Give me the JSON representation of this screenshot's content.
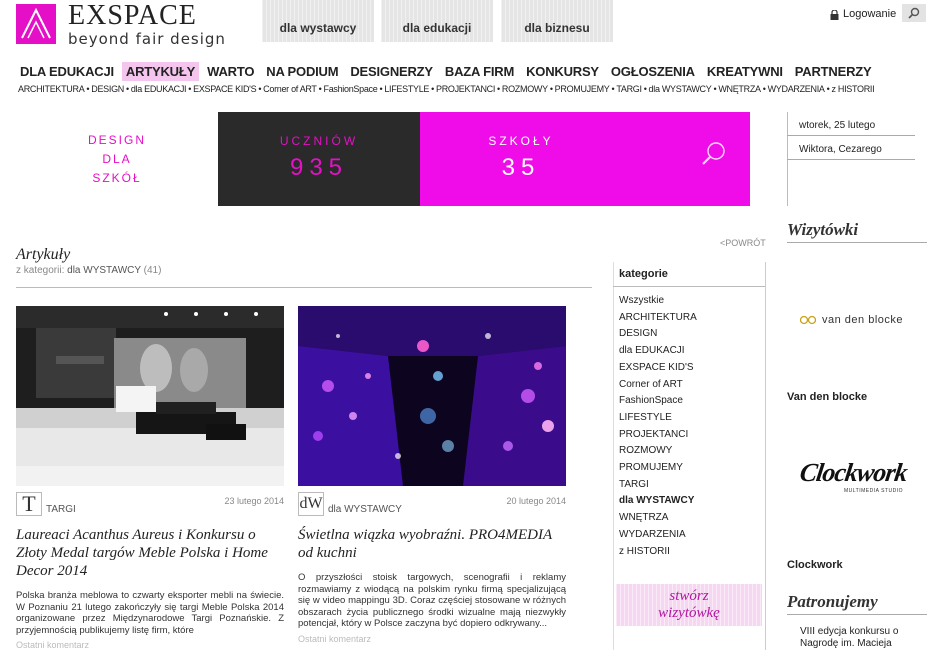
{
  "header": {
    "brand": "EXSPACE",
    "tagline": "beyond fair design",
    "top_tabs": [
      "dla wystawcy",
      "dla edukacji",
      "dla biznesu"
    ],
    "login_label": "Logowanie"
  },
  "main_nav": [
    "DLA EDUKACJI",
    "ARTYKUŁY",
    "WARTO",
    "NA PODIUM",
    "DESIGNERZY",
    "BAZA FIRM",
    "KONKURSY",
    "OGŁOSZENIA",
    "KREATYWNI",
    "PARTNERZY"
  ],
  "sub_nav": [
    "ARCHITEKTURA",
    "DESIGN",
    "dla EDUKACJI",
    "EXSPACE KID'S",
    "Corner of ART",
    "FashionSpace",
    "LIFESTYLE",
    "PROJEKTANCI",
    "ROZMOWY",
    "PROMUJEMY",
    "TARGI",
    "dla WYSTAWCY",
    "WNĘTRZA",
    "WYDARZENIA",
    "z HISTORII"
  ],
  "banner": {
    "left_lines": [
      "DESIGN",
      "DLA",
      "SZKÓŁ"
    ],
    "students_label": "UCZNIÓW",
    "students_value": "935",
    "schools_label": "SZKOŁY",
    "schools_value": "35"
  },
  "date_box": {
    "date": "wtorek, 25 lutego",
    "names": "Wiktora, Cezarego"
  },
  "articles": {
    "title": "Artykuły",
    "from_category_prefix": "z kategorii:",
    "category": "dla WYSTAWCY",
    "count": "(41)",
    "back_label": "<POWRÓT",
    "items": [
      {
        "category_letter": "T",
        "category": "TARGI",
        "date": "23 lutego 2014",
        "title": "Laureaci Acanthus Aureus i Konkursu o Złoty Medal targów Meble Polska i Home Decor 2014",
        "text": "Polska branża meblowa to czwarty eksporter mebli na świecie. W Poznaniu 21 lutego zakończyły się targi Meble Polska 2014 organizowane przez Międzynarodowe Targi Poznańskie. Z przyjemnością publikujemy listę firm, które",
        "comments": "Ostatni komentarz"
      },
      {
        "category_letter": "dW",
        "category": "dla WYSTAWCY",
        "date": "20 lutego 2014",
        "title": "Świetlna wiązka wyobraźni. PRO4MEDIA od kuchni",
        "text": "O przyszłości stoisk targowych, scenografii i reklamy rozmawiamy z wiodącą na polskim rynku firmą specjalizującą się w video mappingu 3D. Coraz częściej stosowane w różnych obszarach życia publicznego środki wizualne mają niezwykły potencjał, który w Polsce zaczyna być dopiero odkrywany...",
        "comments": "Ostatni komentarz"
      }
    ]
  },
  "categories": {
    "title": "kategorie",
    "items": [
      "Wszystkie",
      "ARCHITEKTURA",
      "DESIGN",
      "dla EDUKACJI",
      "EXSPACE KID'S",
      "Corner of ART",
      "FashionSpace",
      "LIFESTYLE",
      "PROJEKTANCI",
      "ROZMOWY",
      "PROMUJEMY",
      "TARGI",
      "dla WYSTAWCY",
      "WNĘTRZA",
      "WYDARZENIA",
      "z HISTORII"
    ],
    "active": "dla WYSTAWCY",
    "create_card": [
      "stwórz",
      "wizytówkę"
    ]
  },
  "sidebar": {
    "cards_title": "Wizytówki",
    "company1_logo_text": "van den blocke",
    "company1_name": "Van den blocke",
    "company2_logo_text": "Clockwork",
    "company2_logo_sub": "MULTIMEDIA STUDIO",
    "company2_name": "Clockwork",
    "patrons_title": "Patronujemy",
    "patrons_text": [
      "VIII edycja konkursu o",
      "Nagrodę im. Macieja"
    ]
  },
  "colors": {
    "accent": "#e60fc8",
    "banner_pink": "#f00ce8",
    "banner_dark": "#2a2a2a",
    "active_nav_bg": "#f4c6ee"
  }
}
